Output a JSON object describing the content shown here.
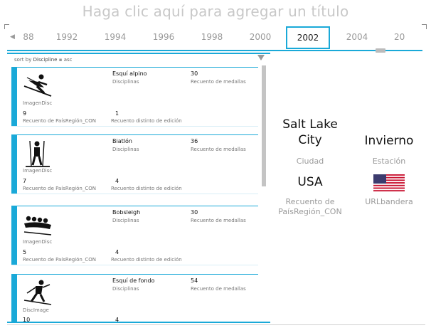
{
  "title": "Haga clic aquí para agregar un título",
  "timeline": {
    "years": [
      "88",
      "1992",
      "1994",
      "1996",
      "1998",
      "2000",
      "2002",
      "2004",
      "20"
    ],
    "selected": "2002"
  },
  "sortbar": {
    "prefix": "sort by",
    "field": "Discipline",
    "order": "asc"
  },
  "tiles": [
    {
      "icon": "alpine-skiing-icon",
      "image_label": "ImagenDisc",
      "discipline": "Esquí alpino",
      "discipline_label": "Disciplinas",
      "medals": "30",
      "medals_label": "Recuento de medallas",
      "countries": "9",
      "countries_label": "Recuento de PaísRegión_CON",
      "editions": "1",
      "editions_label": "Recuento distinto de edición"
    },
    {
      "icon": "biathlon-icon",
      "image_label": "ImagenDisc",
      "discipline": "Biatlón",
      "discipline_label": "Disciplinas",
      "medals": "36",
      "medals_label": "Recuento de medallas",
      "countries": "7",
      "countries_label": "Recuento de PaísRegión_CON",
      "editions": "4",
      "editions_label": "Recuento distinto de edición"
    },
    {
      "icon": "bobsleigh-icon",
      "image_label": "ImagenDisc",
      "discipline": "Bobsleigh",
      "discipline_label": "Disciplinas",
      "medals": "30",
      "medals_label": "Recuento de medallas",
      "countries": "5",
      "countries_label": "Recuento de PaísRegión_CON",
      "editions": "4",
      "editions_label": "Recuento distinto de edición"
    },
    {
      "icon": "cross-country-skiing-icon",
      "image_label": "DiscImage",
      "discipline": "Esquí de fondo",
      "discipline_label": "Disciplinas",
      "medals": "54",
      "medals_label": "Recuento de medallas",
      "countries": "10",
      "countries_label": "",
      "editions": "4",
      "editions_label": ""
    }
  ],
  "card": {
    "city": "Salt Lake City",
    "city_label": "Ciudad",
    "season": "Invierno",
    "season_label": "Estación",
    "country": "USA",
    "country_label": "Recuento de PaísRegión_CON",
    "flag_icon": "us-flag-icon",
    "flag_label": "URLbandera"
  },
  "colors": {
    "accent": "#1aa9d8",
    "muted": "#9a9a9a"
  }
}
